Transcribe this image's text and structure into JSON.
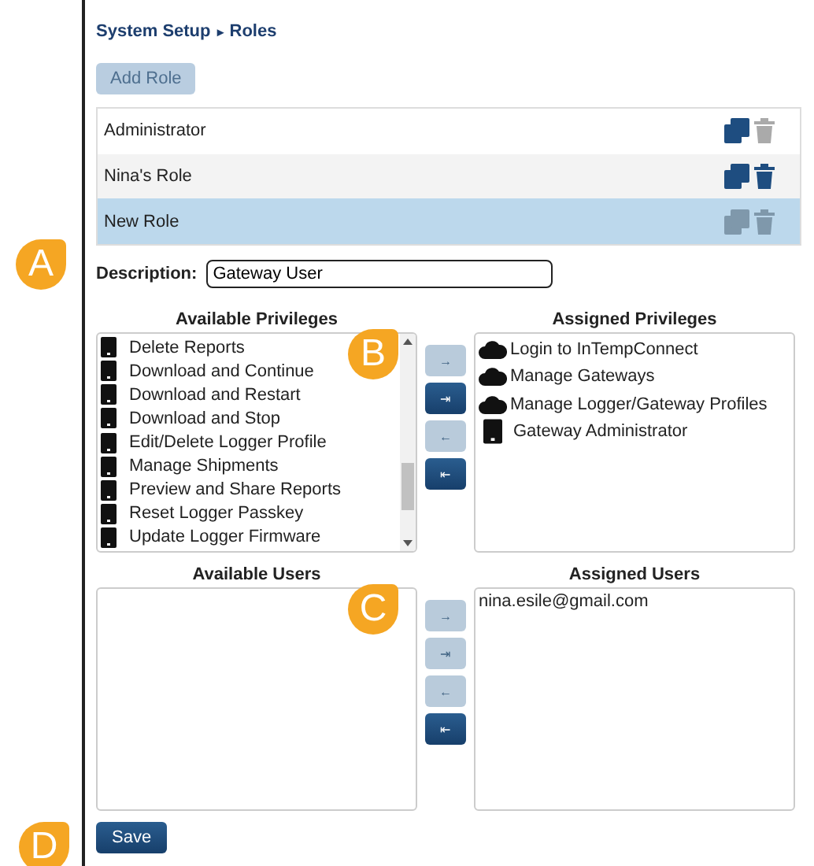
{
  "breadcrumb": {
    "parent": "System Setup",
    "separator": "▸",
    "current": "Roles"
  },
  "add_button": {
    "label": "Add Role",
    "disabled": true
  },
  "roles": [
    {
      "name": "Administrator",
      "selected": false,
      "copy_enabled": true,
      "delete_enabled": false
    },
    {
      "name": "Nina's Role",
      "selected": false,
      "copy_enabled": true,
      "delete_enabled": true
    },
    {
      "name": "New Role",
      "selected": true,
      "copy_enabled": false,
      "delete_enabled": false
    }
  ],
  "description": {
    "callout": "A",
    "label": "Description:",
    "value": "Gateway User"
  },
  "privileges": {
    "callout": "B",
    "available_title": "Available Privileges",
    "assigned_title": "Assigned Privileges",
    "available": [
      {
        "label": "Delete Reports",
        "kind": "device"
      },
      {
        "label": "Download and Continue",
        "kind": "device"
      },
      {
        "label": "Download and Restart",
        "kind": "device"
      },
      {
        "label": "Download and Stop",
        "kind": "device"
      },
      {
        "label": "Edit/Delete Logger Profile",
        "kind": "device"
      },
      {
        "label": "Manage Shipments",
        "kind": "device"
      },
      {
        "label": "Preview and Share Reports",
        "kind": "device"
      },
      {
        "label": "Reset Logger Passkey",
        "kind": "device"
      },
      {
        "label": "Update Logger Firmware",
        "kind": "device"
      }
    ],
    "assigned": [
      {
        "label": "Login to InTempConnect",
        "kind": "cloud"
      },
      {
        "label": "Manage Gateways",
        "kind": "cloud"
      },
      {
        "label": "Manage Logger/Gateway Profiles",
        "kind": "cloud"
      },
      {
        "label": "Gateway Administrator",
        "kind": "device"
      }
    ],
    "buttons": [
      {
        "glyph": "→",
        "enabled": false
      },
      {
        "glyph": "⇥",
        "enabled": true
      },
      {
        "glyph": "←",
        "enabled": false
      },
      {
        "glyph": "⇤",
        "enabled": true
      }
    ]
  },
  "users": {
    "callout": "C",
    "available_title": "Available Users",
    "assigned_title": "Assigned Users",
    "assigned": [
      "nina.esile@gmail.com"
    ],
    "buttons": [
      {
        "glyph": "→",
        "enabled": false
      },
      {
        "glyph": "⇥",
        "enabled": false
      },
      {
        "glyph": "←",
        "enabled": false
      },
      {
        "glyph": "⇤",
        "enabled": true
      }
    ]
  },
  "save": {
    "callout": "D",
    "label": "Save"
  }
}
